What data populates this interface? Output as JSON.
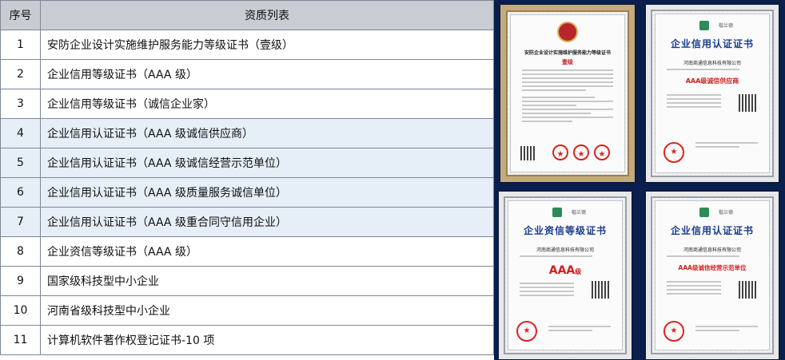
{
  "table": {
    "headers": {
      "index": "序号",
      "title": "资质列表"
    },
    "rows": [
      {
        "index": "1",
        "title": "安防企业设计实施维护服务能力等级证书（壹级）",
        "highlight": false
      },
      {
        "index": "2",
        "title": "企业信用等级证书（AAA 级）",
        "highlight": false
      },
      {
        "index": "3",
        "title": "企业信用等级证书（诚信企业家）",
        "highlight": false
      },
      {
        "index": "4",
        "title": "企业信用认证证书（AAA 级诚信供应商）",
        "highlight": true
      },
      {
        "index": "5",
        "title": "企业信用认证证书（AAA 级诚信经营示范单位）",
        "highlight": true
      },
      {
        "index": "6",
        "title": "企业信用认证证书（AAA 级质量服务诚信单位）",
        "highlight": true
      },
      {
        "index": "7",
        "title": "企业信用认证证书（AAA 级重合同守信用企业）",
        "highlight": true
      },
      {
        "index": "8",
        "title": "企业资信等级证书（AAA 级）",
        "highlight": false
      },
      {
        "index": "9",
        "title": "国家级科技型中小企业",
        "highlight": false
      },
      {
        "index": "10",
        "title": "河南省级科技型中小企业",
        "highlight": false
      },
      {
        "index": "11",
        "title": "计算机软件著作权登记证书-10 项",
        "highlight": false
      }
    ]
  },
  "certificates": [
    {
      "title": "安防企业设计实施维护服务能力等级证书",
      "level": "壹级",
      "brand": "",
      "company": "",
      "frame_color": "#b9a070"
    },
    {
      "title": "企业信用认证证书",
      "level": "AAA级诚信供应商",
      "brand": "楷兰德",
      "company": "河南商通信息科技有限公司",
      "frame_color": "#e8e8e8"
    },
    {
      "title": "企业资信等级证书",
      "level": "AAA",
      "level_suffix": "级",
      "brand": "楷兰德",
      "company": "河南商通信息科技有限公司",
      "frame_color": "#e8e8e8"
    },
    {
      "title": "企业信用认证证书",
      "level": "AAA级诚信经营示范单位",
      "brand": "楷兰德",
      "company": "河南商通信息科技有限公司",
      "frame_color": "#e8e8e8"
    }
  ],
  "colors": {
    "background": "#0a1f4d",
    "header_bg": "#c9cdd3",
    "highlight_row": "#e6eef8",
    "cert_title": "#1a3d8f",
    "cert_level": "#d21f1f"
  }
}
